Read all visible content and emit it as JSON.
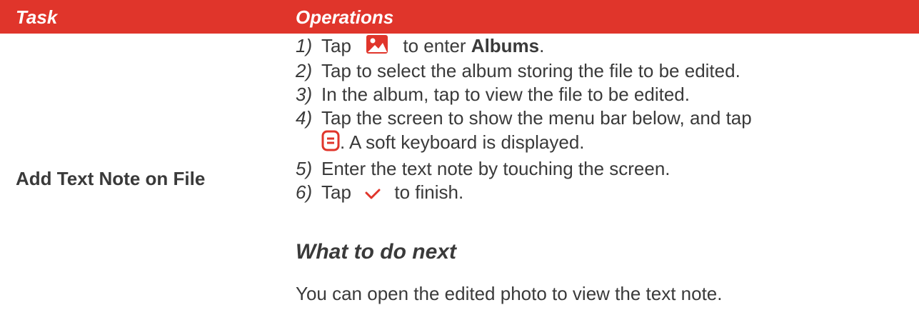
{
  "header": {
    "task": "Task",
    "operations": "Operations"
  },
  "task_name": "Add Text Note on File",
  "steps": [
    {
      "num": "1)",
      "pre": "Tap",
      "icon": "albums-icon",
      "mid": "to enter",
      "strong": "Albums",
      "post": "."
    },
    {
      "num": "2)",
      "text": "Tap to select the album storing the file to be edited."
    },
    {
      "num": "3)",
      "text": "In the album, tap to view the file to be edited."
    },
    {
      "num": "4)",
      "line1": "Tap the screen to show the menu bar below, and tap",
      "icon": "text-note-icon",
      "line2": ". A soft keyboard is displayed."
    },
    {
      "num": "5)",
      "text": "Enter the text note by touching the screen."
    },
    {
      "num": "6)",
      "pre": "Tap",
      "icon": "checkmark-icon",
      "post": "to finish."
    }
  ],
  "next_heading": "What to do next",
  "next_text": "You can open the edited photo to view the text note.",
  "colors": {
    "accent": "#e0352b",
    "text": "#3a3a3a",
    "header_text": "#ffffff"
  }
}
